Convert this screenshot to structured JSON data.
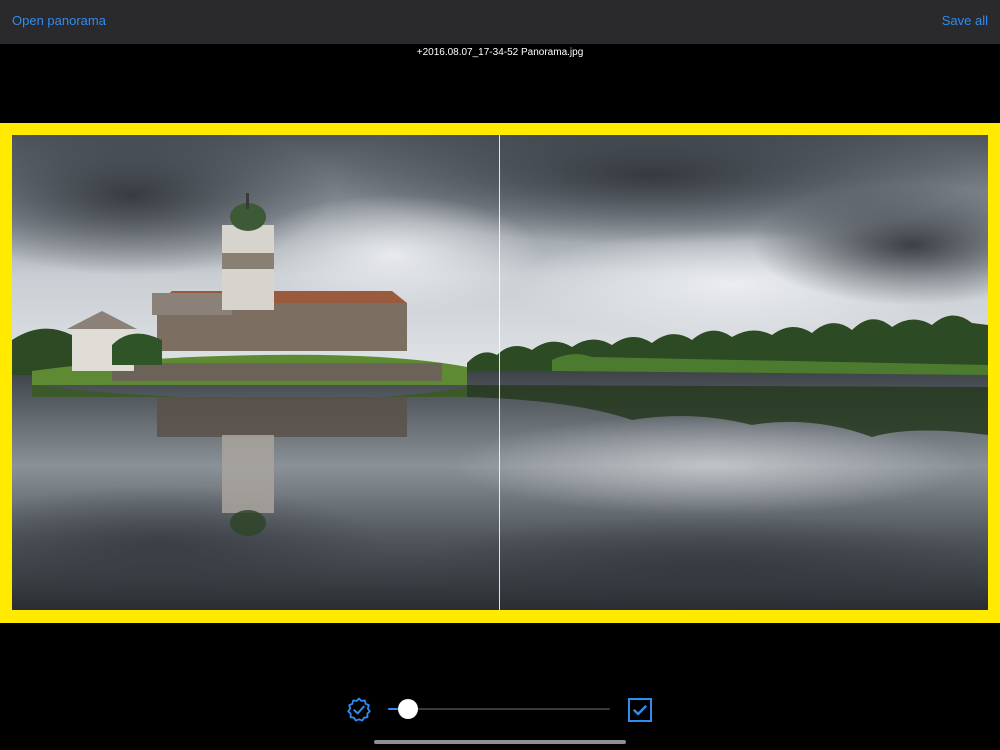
{
  "navbar": {
    "left_button": "Open panorama",
    "right_button": "Save all"
  },
  "file": {
    "name": "+2016.08.07_17-34-52 Panorama.jpg"
  },
  "photo": {
    "subject": "panorama of a castle with a tower on an island beside a lake with trees"
  },
  "controls": {
    "settings_icon": "gear-check-icon",
    "slider_value": 0.05,
    "checkbox_icon": "checkbox-checked-icon",
    "checkbox_checked": true
  },
  "colors": {
    "accent": "#2f8cf0",
    "frame": "#ffea00",
    "navbar": "#2a2a2c",
    "background": "#000000"
  }
}
